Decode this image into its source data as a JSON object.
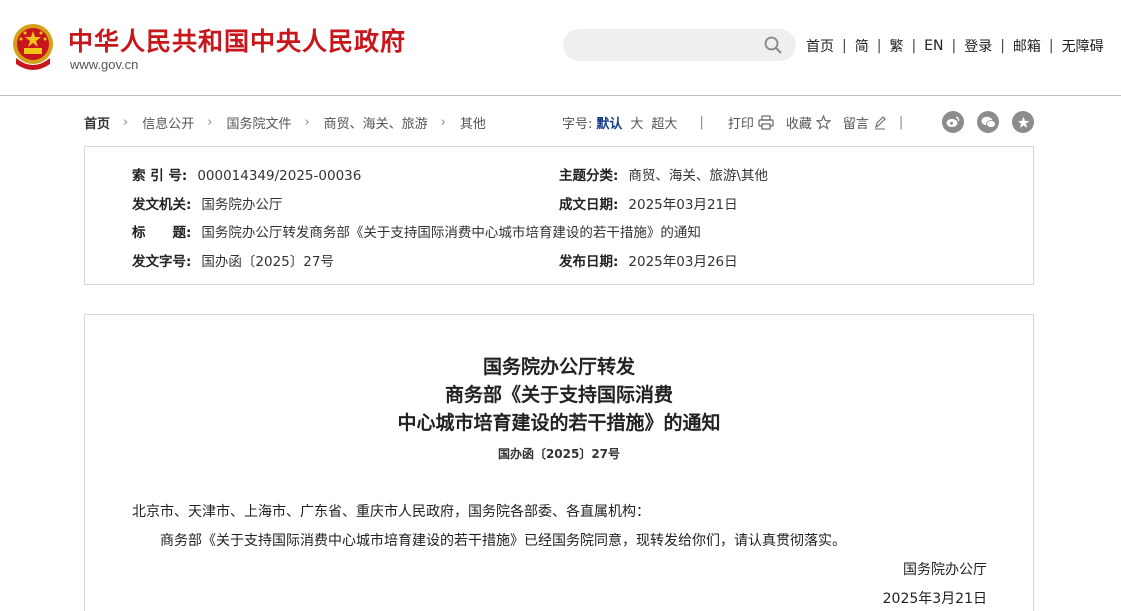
{
  "header": {
    "site_title": "中华人民共和国中央人民政府",
    "site_url": "www.gov.cn",
    "search_placeholder": "",
    "nav": [
      "首页",
      "简",
      "繁",
      "EN",
      "登录",
      "邮箱",
      "无障碍"
    ],
    "nav_separator": "|",
    "accent_color": "#c8161d"
  },
  "breadcrumb": {
    "items": [
      "首页",
      "信息公开",
      "国务院文件",
      "商贸、海关、旅游",
      "其他"
    ],
    "arrow": "›"
  },
  "tools": {
    "font_size_label": "字号:",
    "size_default": "默认",
    "size_large": "大",
    "size_xlarge": "超大",
    "separator": "|",
    "print": "打印",
    "favorite": "收藏",
    "comment": "留言",
    "share_icons": [
      "weibo-icon",
      "wechat-icon",
      "star-icon"
    ]
  },
  "meta": {
    "index_label": "索 引 号:",
    "index_value": "000014349/2025-00036",
    "topic_label": "主题分类:",
    "topic_value": "商贸、海关、旅游\\其他",
    "issuer_label": "发文机关:",
    "issuer_value": "国务院办公厅",
    "written_label": "成文日期:",
    "written_value": "2025年03月21日",
    "title_label": "标　　题:",
    "title_value": "国务院办公厅转发商务部《关于支持国际消费中心城市培育建设的若干措施》的通知",
    "docno_label": "发文字号:",
    "docno_value": "国办函〔2025〕27号",
    "published_label": "发布日期:",
    "published_value": "2025年03月26日"
  },
  "document": {
    "title_line1": "国务院办公厅转发",
    "title_line2": "商务部《关于支持国际消费",
    "title_line3": "中心城市培育建设的若干措施》的通知",
    "doc_number": "国办函〔2025〕27号",
    "addressee": "北京市、天津市、上海市、广东省、重庆市人民政府，国务院各部委、各直属机构：",
    "body": "商务部《关于支持国际消费中心城市培育建设的若干措施》已经国务院同意，现转发给你们，请认真贯彻落实。",
    "signer": "国务院办公厅",
    "date": "2025年3月21日"
  }
}
